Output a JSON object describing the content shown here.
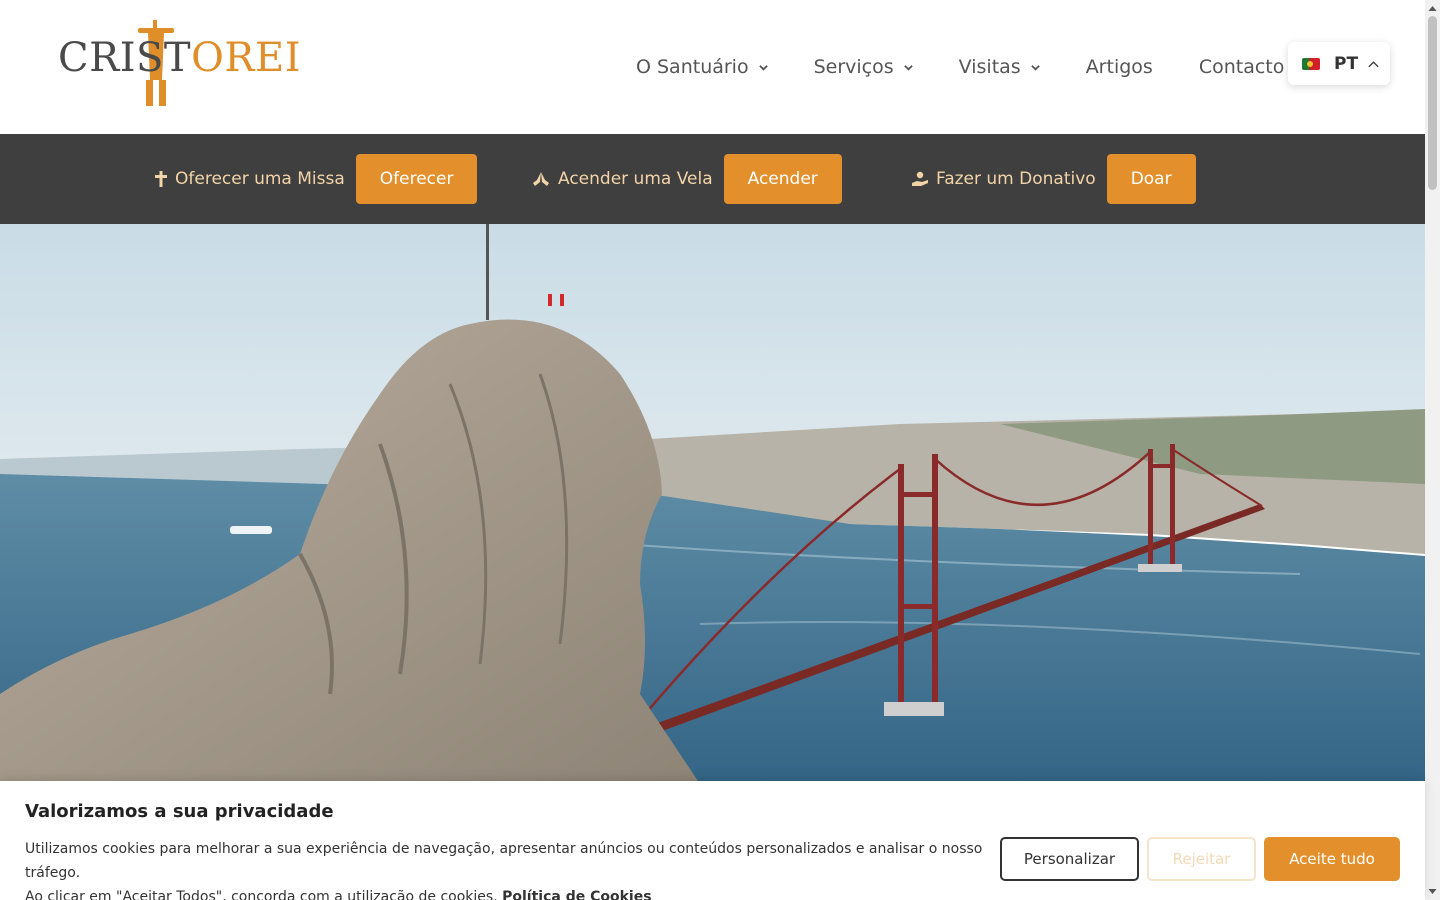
{
  "header": {
    "logo": {
      "part1": "CRIST",
      "part2": "O",
      "part3": "REI"
    },
    "nav": [
      {
        "label": "O Santuário",
        "has_dropdown": true
      },
      {
        "label": "Serviços",
        "has_dropdown": true
      },
      {
        "label": "Visitas",
        "has_dropdown": true
      },
      {
        "label": "Artigos",
        "has_dropdown": false
      },
      {
        "label": "Contacto",
        "has_dropdown": false
      }
    ],
    "language": {
      "label": "PT",
      "flag": "portugal-flag"
    }
  },
  "actionbar": {
    "items": [
      {
        "icon": "cross-icon",
        "label": "Oferecer uma Missa",
        "button": "Oferecer"
      },
      {
        "icon": "praying-hands-icon",
        "label": "Acender uma Vela",
        "button": "Acender"
      },
      {
        "icon": "donate-hand-icon",
        "label": "Fazer um Donativo",
        "button": "Doar"
      }
    ]
  },
  "cookie": {
    "title": "Valorizamos a sua privacidade",
    "text_line1": "Utilizamos cookies para melhorar a sua experiência de navegação, apresentar anúncios ou conteúdos personalizados e analisar o nosso tráfego.",
    "text_line2": "Ao clicar em \"Aceitar Todos\", concorda com a utilização de cookies.",
    "policy_link": "Política de Cookies",
    "buttons": {
      "customize": "Personalizar",
      "reject": "Rejeitar",
      "accept": "Aceite tudo"
    }
  },
  "colors": {
    "accent": "#e3902c",
    "bar": "#3f3f3f",
    "bridge": "#8a2a2a"
  }
}
